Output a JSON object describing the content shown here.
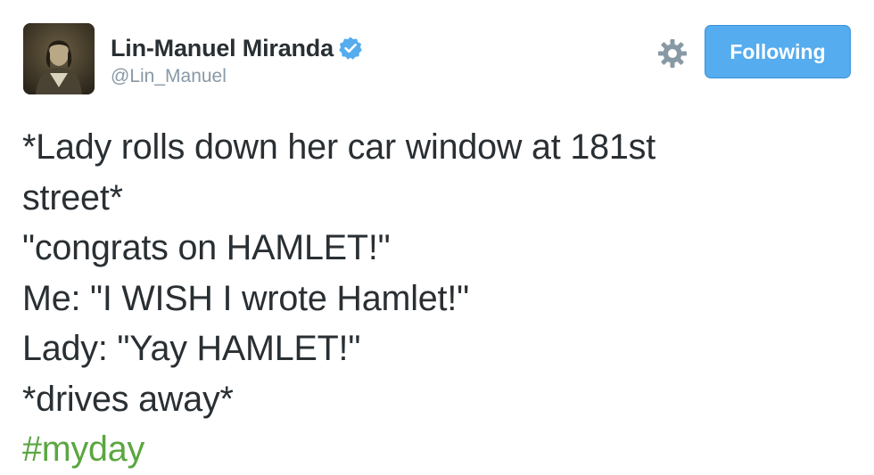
{
  "user": {
    "display_name": "Lin-Manuel Miranda",
    "handle": "@Lin_Manuel",
    "verified": true
  },
  "actions": {
    "follow_label": "Following",
    "settings_icon": "gear-icon"
  },
  "tweet": {
    "lines": [
      "*Lady rolls down her car window at 181st",
      "street*",
      "\"congrats on HAMLET!\"",
      "Me: \"I WISH I wrote Hamlet!\"",
      "Lady: \"Yay HAMLET!\"",
      "*drives away*"
    ],
    "hashtag": "#myday"
  },
  "colors": {
    "follow_button": "#55acee",
    "hashtag": "#5aa640",
    "verified_badge": "#55acee",
    "handle": "#8899a6"
  }
}
